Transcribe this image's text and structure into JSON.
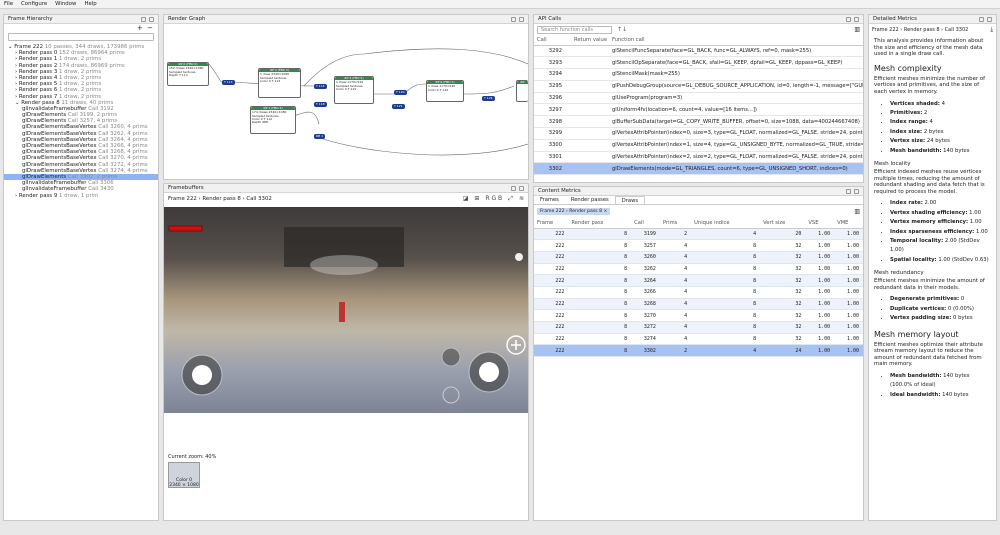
{
  "menu": [
    "File",
    "Configure",
    "Window",
    "Help"
  ],
  "frame_hierarchy": {
    "title": "Frame Hierarchy",
    "items": [
      {
        "t": "⌄ Frame 222",
        "g": " 10 passes, 344 draws, 173986 prims",
        "ind": 0
      },
      {
        "t": "› Render pass 0",
        "g": " 152 draws, 86964 prims",
        "ind": 1
      },
      {
        "t": "› Render pass 1",
        "g": " 1 draw, 2 prims",
        "ind": 1
      },
      {
        "t": "› Render pass 2",
        "g": " 174 draws, 86969 prims",
        "ind": 1
      },
      {
        "t": "› Render pass 3",
        "g": " 1 draw, 2 prims",
        "ind": 1
      },
      {
        "t": "› Render pass 4",
        "g": " 1 draw, 2 prims",
        "ind": 1
      },
      {
        "t": "› Render pass 5",
        "g": " 1 draw, 2 prims",
        "ind": 1
      },
      {
        "t": "› Render pass 6",
        "g": " 1 draw, 2 prims",
        "ind": 1
      },
      {
        "t": "› Render pass 7",
        "g": " 1 draw, 2 prims",
        "ind": 1
      },
      {
        "t": "⌄ Render pass 8",
        "g": " 11 draws, 40 prims",
        "ind": 1
      },
      {
        "t": "glInvalidateFramebuffer",
        "g": " Call 3192",
        "ind": 2
      },
      {
        "t": "glDrawElements",
        "g": " Call 3199, 2 prims",
        "ind": 2
      },
      {
        "t": "glDrawElements",
        "g": " Call 3257, 4 prims",
        "ind": 2
      },
      {
        "t": "glDrawElementsBaseVertex",
        "g": " Call 3260, 4 prims",
        "ind": 2
      },
      {
        "t": "glDrawElementsBaseVertex",
        "g": " Call 3262, 4 prims",
        "ind": 2
      },
      {
        "t": "glDrawElementsBaseVertex",
        "g": " Call 3264, 4 prims",
        "ind": 2
      },
      {
        "t": "glDrawElementsBaseVertex",
        "g": " Call 3266, 4 prims",
        "ind": 2
      },
      {
        "t": "glDrawElementsBaseVertex",
        "g": " Call 3268, 4 prims",
        "ind": 2
      },
      {
        "t": "glDrawElementsBaseVertex",
        "g": " Call 3270, 4 prims",
        "ind": 2
      },
      {
        "t": "glDrawElementsBaseVertex",
        "g": " Call 3272, 4 prims",
        "ind": 2
      },
      {
        "t": "glDrawElementsBaseVertex",
        "g": " Call 3274, 4 prims",
        "ind": 2
      },
      {
        "t": "glDrawElements",
        "g": " Call 3302, 2 prims",
        "ind": 2,
        "sel": true
      },
      {
        "t": "glInvalidateFramebuffer",
        "g": " Call 3306",
        "ind": 2
      },
      {
        "t": "glInvalidateFramebuffer",
        "g": " Call 3430",
        "ind": 2
      },
      {
        "t": "› Render pass 9",
        "g": " 1 draw, 1 prim",
        "ind": 1
      }
    ]
  },
  "render_graph": {
    "title": "Render Graph"
  },
  "framebuffers": {
    "title": "Framebuffers",
    "breadcrumb": "Frame 222 › Render pass 8 › Call 3302",
    "zoom": "Current zoom: 40%",
    "thumb_label": "Color 0",
    "thumb_size": "2340 × 1080"
  },
  "api_calls": {
    "title": "API Calls",
    "search_placeholder": "Search function calls",
    "headers": [
      "Call",
      "Return value",
      "Function call"
    ],
    "rows": [
      [
        "3292",
        "",
        "glStencilFuncSeparate(face=GL_BACK, func=GL_ALWAYS, ref=0, mask=255)"
      ],
      [
        "3293",
        "",
        "glStencilOpSeparate(face=GL_BACK, sfail=GL_KEEP, dpfail=GL_KEEP, dppass=GL_KEEP)"
      ],
      [
        "3294",
        "",
        "glStencilMask(mask=255)"
      ],
      [
        "3295",
        "",
        "glPushDebugGroup(source=GL_DEBUG_SOURCE_APPLICATION, id=0, length=-1, message=[\"GUITex"
      ],
      [
        "3296",
        "",
        "glUseProgram(program=3)"
      ],
      [
        "3297",
        "",
        "glUniform4fv(location=6, count=4, value=[16 items...])"
      ],
      [
        "3298",
        "",
        "glBufferSubData(target=GL_COPY_WRITE_BUFFER, offset=0, size=1088, data=400244667408)"
      ],
      [
        "3299",
        "",
        "glVertexAttribPointer(index=0, size=3, type=GL_FLOAT, normalized=GL_FALSE, stride=24, pointer=0)"
      ],
      [
        "3300",
        "",
        "glVertexAttribPointer(index=1, size=4, type=GL_UNSIGNED_BYTE, normalized=GL_TRUE, stride=24, p"
      ],
      [
        "3301",
        "",
        "glVertexAttribPointer(index=2, size=2, type=GL_FLOAT, normalized=GL_FALSE, stride=24, pointer=16"
      ],
      [
        "3302",
        "",
        "glDrawElements(mode=GL_TRIANGLES, count=6, type=GL_UNSIGNED_SHORT, indices=0)"
      ]
    ]
  },
  "content_metrics": {
    "title": "Content Metrics",
    "tabs": [
      "Frames",
      "Render passes",
      "Draws"
    ],
    "active_tab": "Draws",
    "filter": "Frame 222 › Render pass 8 ×",
    "headers": [
      "Frame",
      "Render pass",
      "Call",
      "Prims",
      "Unique indice",
      "Vert size",
      "VSE",
      "VME"
    ],
    "rows": [
      [
        "222",
        "8",
        "3199",
        "2",
        "4",
        "20",
        "1.00",
        "1.00"
      ],
      [
        "222",
        "8",
        "3257",
        "4",
        "8",
        "32",
        "1.00",
        "1.00"
      ],
      [
        "222",
        "8",
        "3260",
        "4",
        "8",
        "32",
        "1.00",
        "1.00"
      ],
      [
        "222",
        "8",
        "3262",
        "4",
        "8",
        "32",
        "1.00",
        "1.00"
      ],
      [
        "222",
        "8",
        "3264",
        "4",
        "8",
        "32",
        "1.00",
        "1.00"
      ],
      [
        "222",
        "8",
        "3266",
        "4",
        "8",
        "32",
        "1.00",
        "1.00"
      ],
      [
        "222",
        "8",
        "3268",
        "4",
        "8",
        "32",
        "1.00",
        "1.00"
      ],
      [
        "222",
        "8",
        "3270",
        "4",
        "8",
        "32",
        "1.00",
        "1.00"
      ],
      [
        "222",
        "8",
        "3272",
        "4",
        "8",
        "32",
        "1.00",
        "1.00"
      ],
      [
        "222",
        "8",
        "3274",
        "4",
        "8",
        "32",
        "1.00",
        "1.00"
      ],
      [
        "222",
        "8",
        "3302",
        "2",
        "4",
        "24",
        "1.00",
        "1.00"
      ]
    ]
  },
  "detailed_metrics": {
    "title": "Detailed Metrics",
    "breadcrumb": "Frame 222 › Render pass 8 › Call 3302",
    "intro": "This analysis provides information about the size and efficiency of the mesh data used in a single draw call.",
    "h_complexity": "Mesh complexity",
    "p_complexity": "Efficient meshes minimize the number of vertices and primitives, and the size of each vertex in memory.",
    "complexity": [
      [
        "Vertices shaded:",
        "4"
      ],
      [
        "Primitives:",
        "2"
      ],
      [
        "Index range:",
        "4"
      ],
      [
        "Index size:",
        "2 bytes"
      ],
      [
        "Vertex size:",
        "24 bytes"
      ],
      [
        "Mesh bandwidth:",
        "140 bytes"
      ]
    ],
    "h_locality": "Mesh locality",
    "p_locality": "Efficient indexed meshes reuse vertices multiple times, reducing the amount of redundant shading and data fetch that is required to process the model.",
    "locality": [
      [
        "Index rate:",
        "2.00"
      ],
      [
        "Vertex shading efficiency:",
        "1.00"
      ],
      [
        "Vertex memory efficiency:",
        "1.00"
      ],
      [
        "Index sparseness efficiency:",
        "1.00"
      ],
      [
        "Temporal locality:",
        "2.00 (StdDev 1.00)"
      ],
      [
        "Spatial locality:",
        "1.00 (StdDev 0.63)"
      ]
    ],
    "h_redundancy": "Mesh redundancy",
    "p_redundancy": "Efficient meshes minimize the amount of redundant data in their models.",
    "redundancy": [
      [
        "Degenerate primitives:",
        "0"
      ],
      [
        "Duplicate vertices:",
        "0 (0.00%)"
      ],
      [
        "Vertex padding size:",
        "0 bytes"
      ]
    ],
    "h_layout": "Mesh memory layout",
    "p_layout": "Efficient meshes optimize their attribute stream memory layout to reduce the amount of redundant data fetched from main memory.",
    "layout": [
      [
        "Mesh bandwidth:",
        "140 bytes (100.0% of ideal)"
      ],
      [
        "Ideal bandwidth:",
        "140 bytes"
      ]
    ]
  }
}
